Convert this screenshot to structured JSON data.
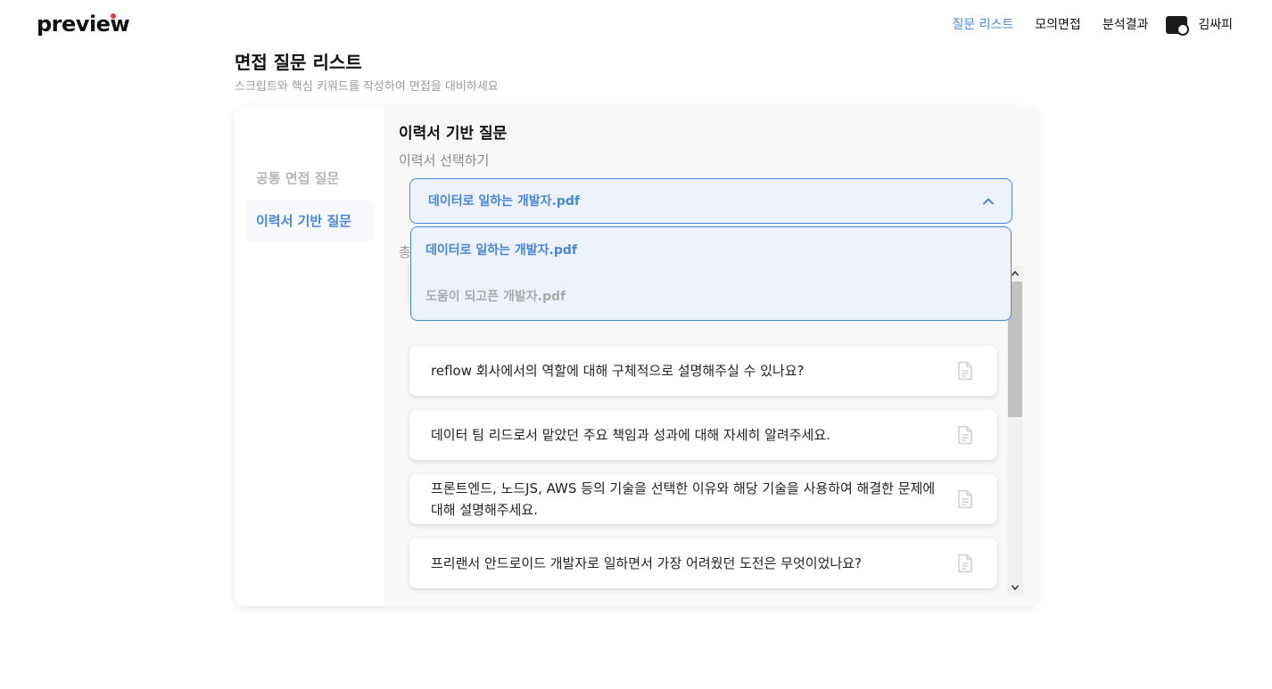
{
  "header": {
    "logo": "preview",
    "nav": [
      {
        "label": "질문 리스트",
        "active": true
      },
      {
        "label": "모의면접",
        "active": false
      },
      {
        "label": "분석결과",
        "active": false
      }
    ],
    "username": "김싸피"
  },
  "page": {
    "title": "면접 질문 리스트",
    "subtitle": "스크립트와 핵심 키워드를 작성하여 면접을 대비하세요"
  },
  "sidebar": {
    "items": [
      {
        "label": "공통 면접 질문",
        "active": false
      },
      {
        "label": "이력서 기반 질문",
        "active": true
      }
    ]
  },
  "main": {
    "title": "이력서 기반 질문",
    "select_label": "이력서 선택하기",
    "selected": "데이터로 일하는 개발자.pdf",
    "options": [
      "데이터로 일하는 개발자.pdf",
      "도움이 되고픈 개발자.pdf"
    ],
    "total_partial": "총",
    "questions": [
      "reflow 회사에서의 역할에 대해 구체적으로 설명해주실 수 있나요?",
      "데이터 팀 리드로서 맡았던 주요 책임과 성과에 대해 자세히 알려주세요.",
      "프론트엔드, 노드JS, AWS 등의 기술을 선택한 이유와 해당 기술을 사용하여 해결한 문제에 대해 설명해주세요.",
      "프리랜서 안드로이드 개발자로 일하면서 가장 어려웠던 도전은 무엇이었나요?"
    ]
  },
  "colors": {
    "accent": "#4a86d8",
    "logo_dot": "#e53935"
  }
}
